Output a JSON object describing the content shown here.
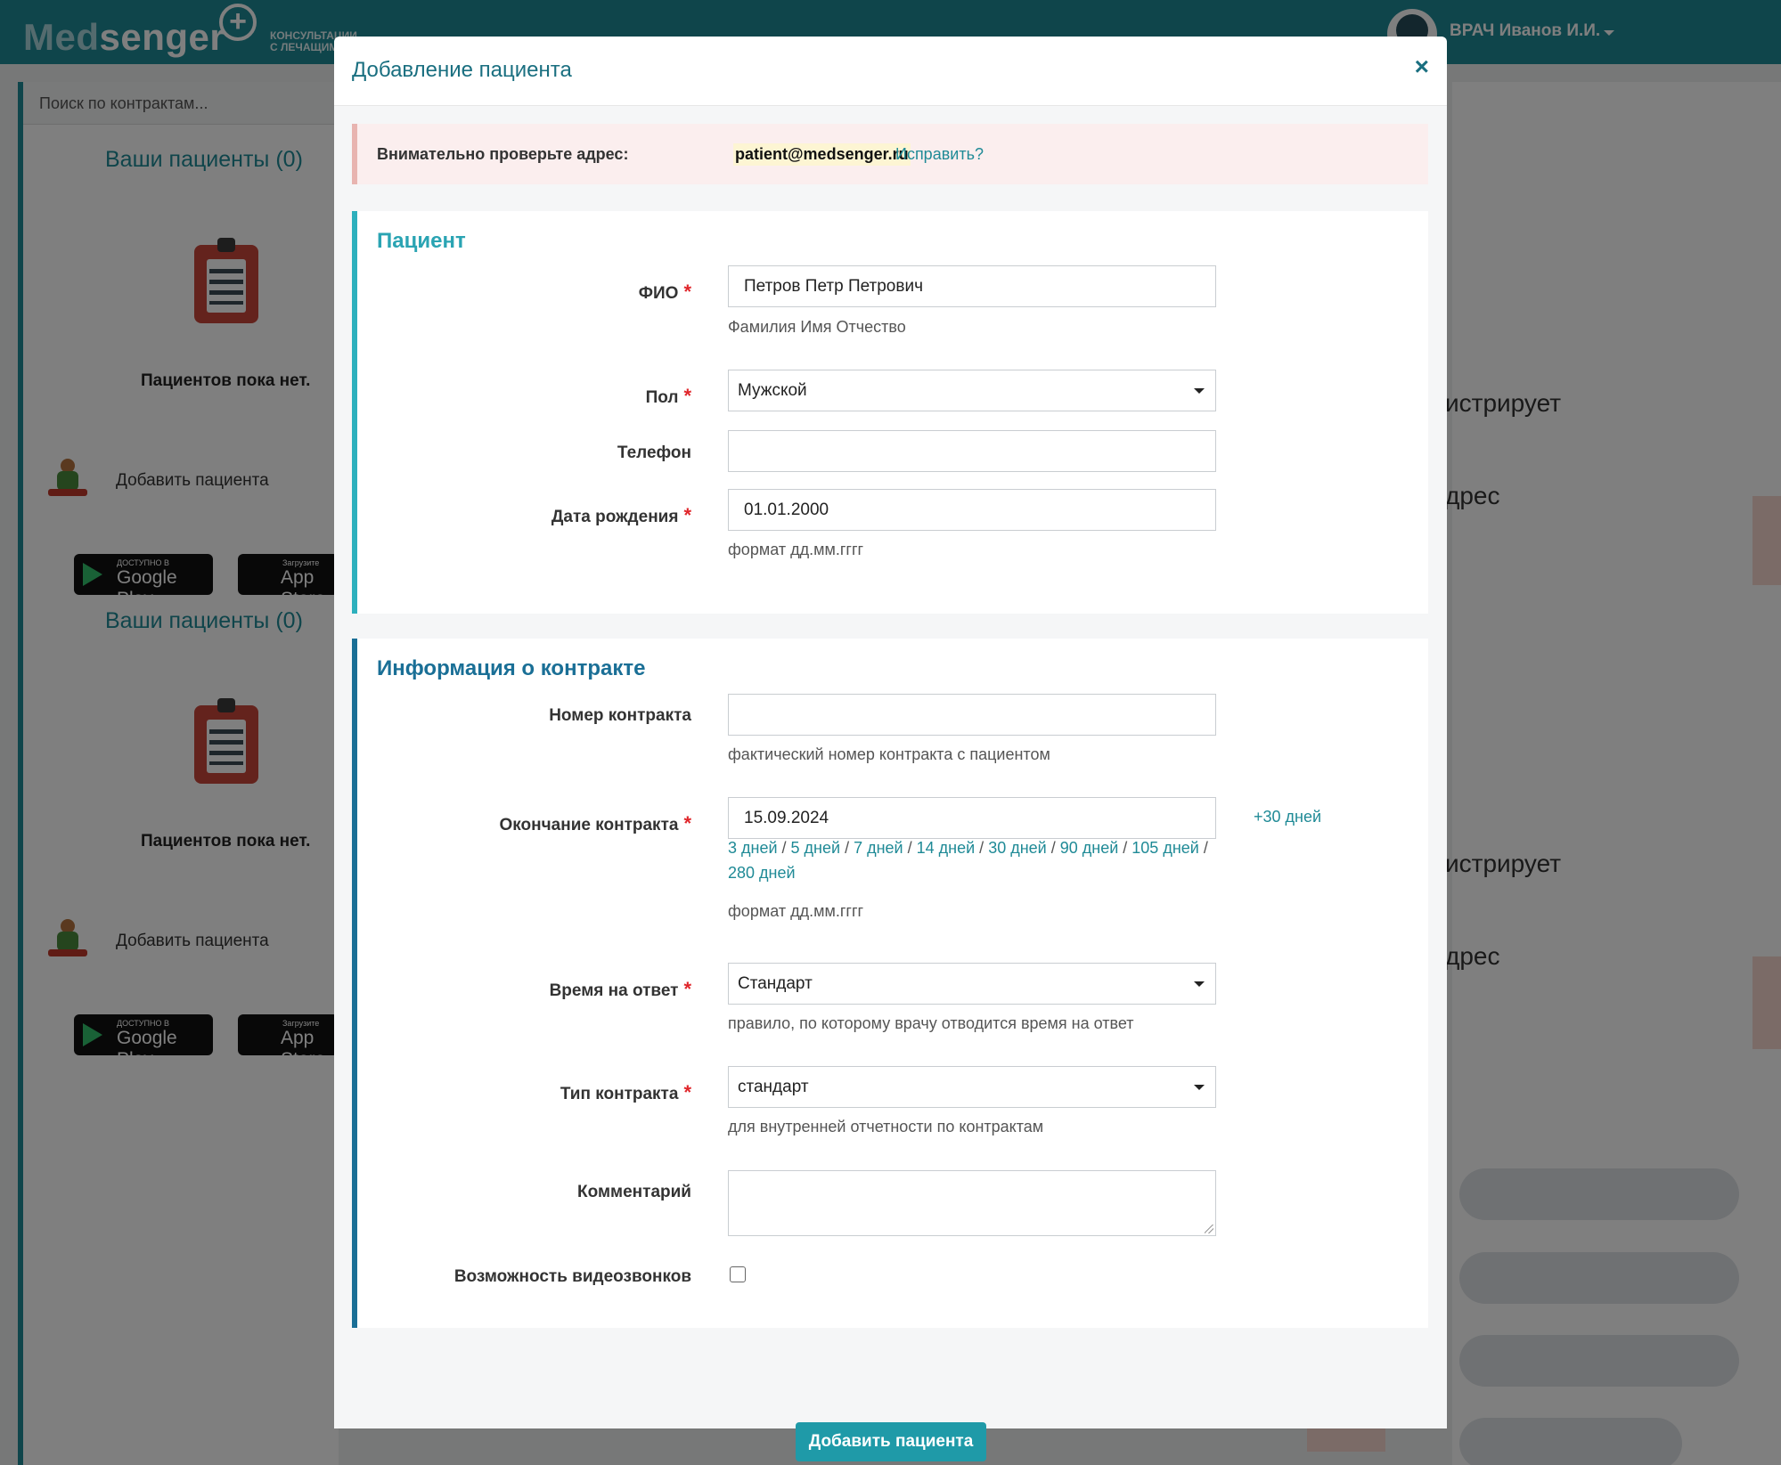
{
  "app": {
    "logo_text_a": "Med",
    "logo_text_b": "senger",
    "logo_plus": "+",
    "tagline_line1": "КОНСУЛЬТАЦИИ",
    "tagline_line2": "С ЛЕЧАЩИМ",
    "user_name": "ВРАЧ Иванов И.И."
  },
  "sidebar": {
    "search_placeholder": "Поиск по контрактам...",
    "patients_title": "Ваши пациенты (0)",
    "empty_text": "Пациентов пока нет.",
    "add_patient": "Добавить пациента",
    "google_small": "ДОСТУПНО В",
    "google_big": "Google Play",
    "apple_small": "Загрузите",
    "apple_big": "App Store"
  },
  "background_right": {
    "text1": "истрирует",
    "text2": "дрес"
  },
  "modal": {
    "title": "Добавление пациента",
    "close": "×",
    "alert": {
      "label": "Внимательно проверьте адрес:",
      "email": "patient@medsenger.ru",
      "fix_link": "Исправить?"
    },
    "patient_section": {
      "title": "Пациент",
      "fio_label": "ФИО",
      "fio_value": "Петров Петр Петрович",
      "fio_help": "Фамилия Имя Отчество",
      "sex_label": "Пол",
      "sex_value": "Мужской",
      "phone_label": "Телефон",
      "phone_value": "",
      "birth_label": "Дата рождения",
      "birth_value": "01.01.2000",
      "birth_help": "формат дд.мм.гггг"
    },
    "contract_section": {
      "title": "Информация о контракте",
      "number_label": "Номер контракта",
      "number_value": "",
      "number_help": "фактический номер контракта с пациентом",
      "end_label": "Окончание контракта",
      "end_value": "15.09.2024",
      "plus30": "+30 дней",
      "quick_links": [
        "3 дней",
        "5 дней",
        "7 дней",
        "14 дней",
        "30 дней",
        "90 дней",
        "105 дней",
        "280 дней"
      ],
      "end_help": "формат дд.мм.гггг",
      "response_label": "Время на ответ",
      "response_value": "Стандарт",
      "response_help": "правило, по которому врачу отводится время на ответ",
      "type_label": "Тип контракта",
      "type_value": "стандарт",
      "type_help": "для внутренней отчетности по контрактам",
      "comment_label": "Комментарий",
      "comment_value": "",
      "video_label": "Возможность видеозвонков",
      "video_checked": false
    },
    "required_mark": "*",
    "submit": "Добавить пациента"
  }
}
